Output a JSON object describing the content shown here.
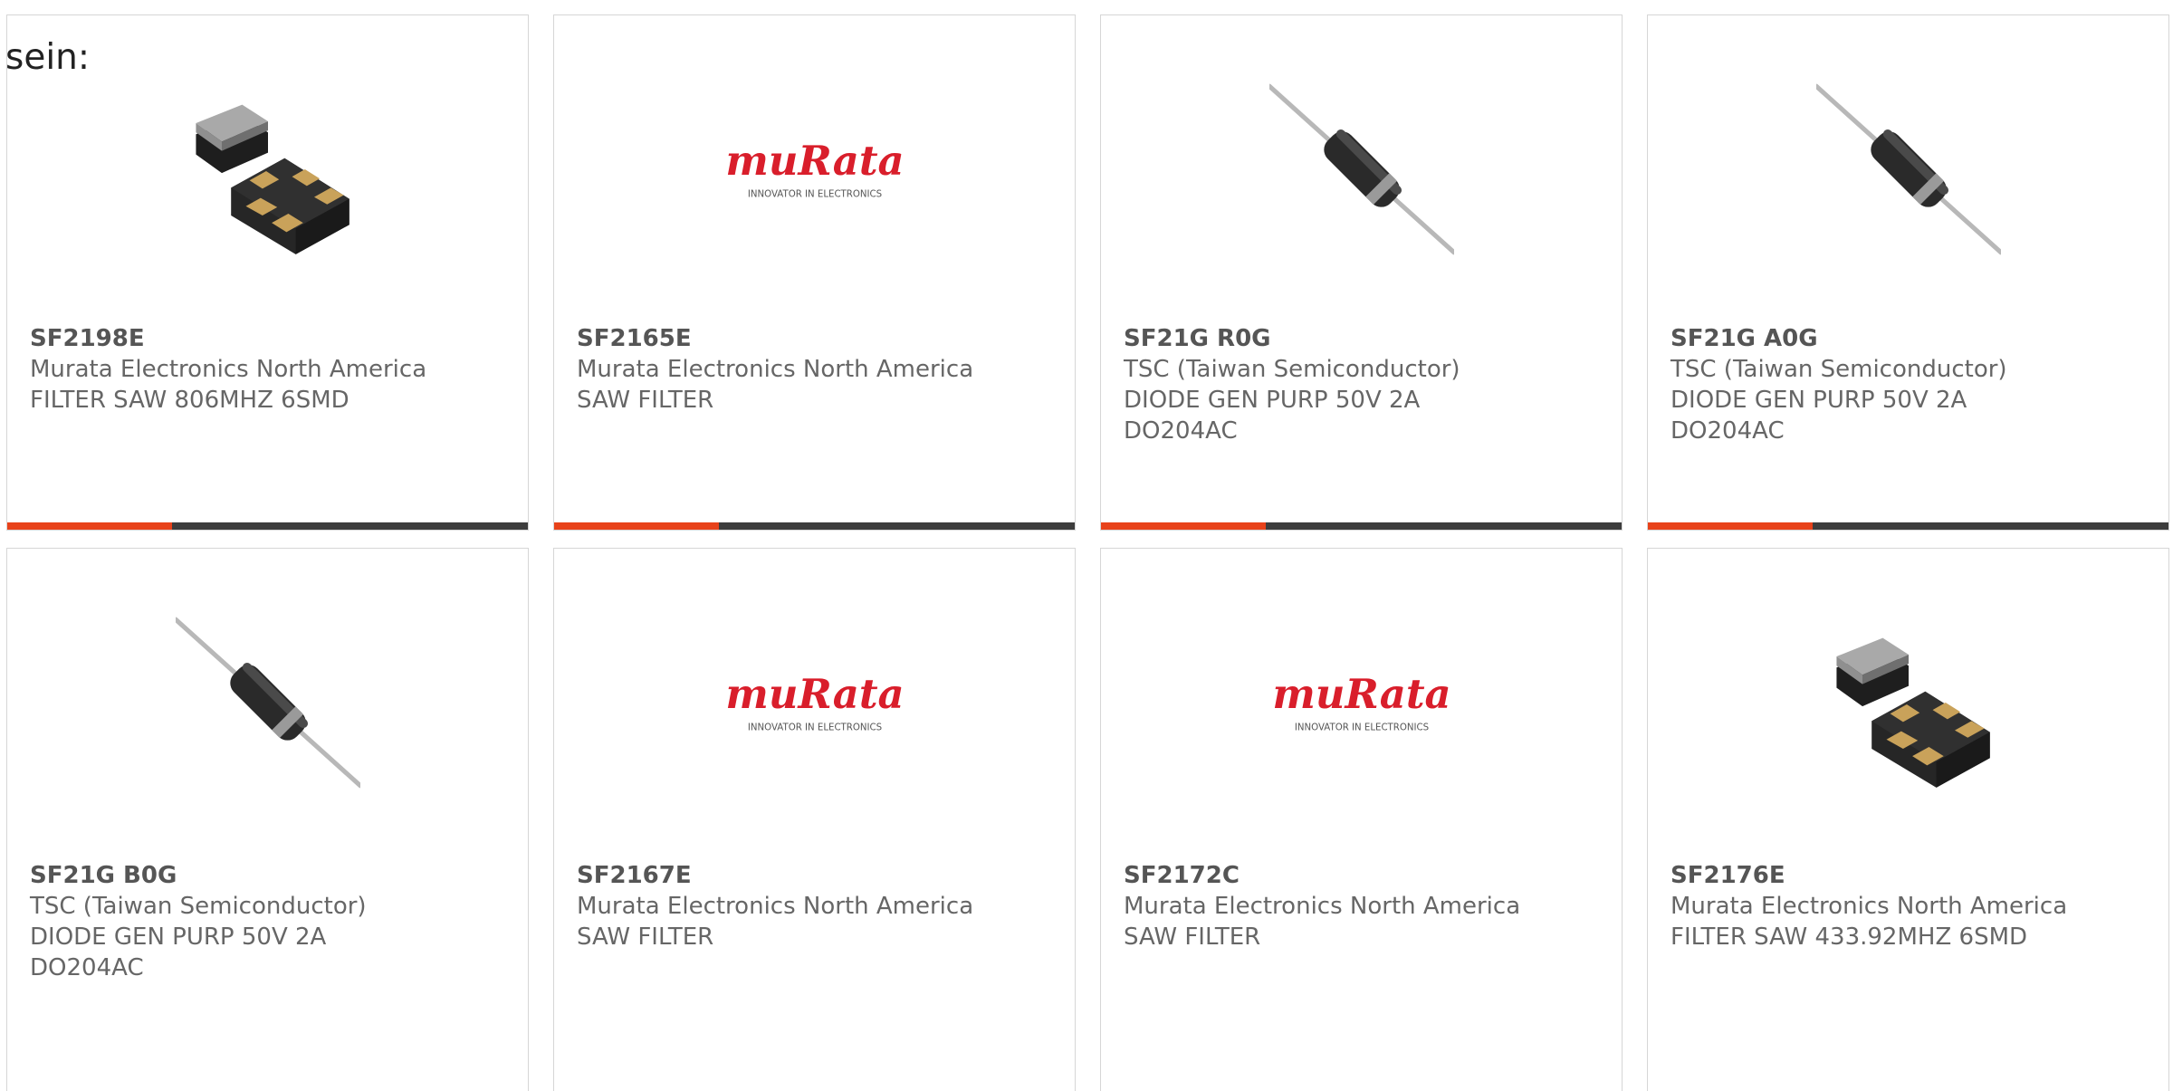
{
  "intro_text": "sein:",
  "colors": {
    "accent": "#e8421a",
    "bar": "#3d3d3d",
    "murata_red": "#d91e2b"
  },
  "products": [
    {
      "part_number": "SF2198E",
      "manufacturer": "Murata Electronics North America",
      "description": "FILTER SAW 806MHZ 6SMD",
      "description2": "",
      "image": "smd-saw-filter-icon"
    },
    {
      "part_number": "SF2165E",
      "manufacturer": "Murata Electronics North America",
      "description": "SAW FILTER",
      "description2": "",
      "image": "murata-logo"
    },
    {
      "part_number": "SF21G R0G",
      "manufacturer": "TSC (Taiwan Semiconductor)",
      "description": "DIODE GEN PURP 50V 2A",
      "description2": "DO204AC",
      "image": "axial-diode-icon"
    },
    {
      "part_number": "SF21G A0G",
      "manufacturer": "TSC (Taiwan Semiconductor)",
      "description": "DIODE GEN PURP 50V 2A",
      "description2": "DO204AC",
      "image": "axial-diode-icon"
    },
    {
      "part_number": "SF21G B0G",
      "manufacturer": "TSC (Taiwan Semiconductor)",
      "description": "DIODE GEN PURP 50V 2A",
      "description2": "DO204AC",
      "image": "axial-diode-icon"
    },
    {
      "part_number": "SF2167E",
      "manufacturer": "Murata Electronics North America",
      "description": "SAW FILTER",
      "description2": "",
      "image": "murata-logo"
    },
    {
      "part_number": "SF2172C",
      "manufacturer": "Murata Electronics North America",
      "description": "SAW FILTER",
      "description2": "",
      "image": "murata-logo"
    },
    {
      "part_number": "SF2176E",
      "manufacturer": "Murata Electronics North America",
      "description": "FILTER SAW 433.92MHZ 6SMD",
      "description2": "",
      "image": "smd-saw-filter-icon"
    }
  ],
  "logo": {
    "wordmark": "muRata",
    "tagline": "INNOVATOR IN ELECTRONICS"
  }
}
